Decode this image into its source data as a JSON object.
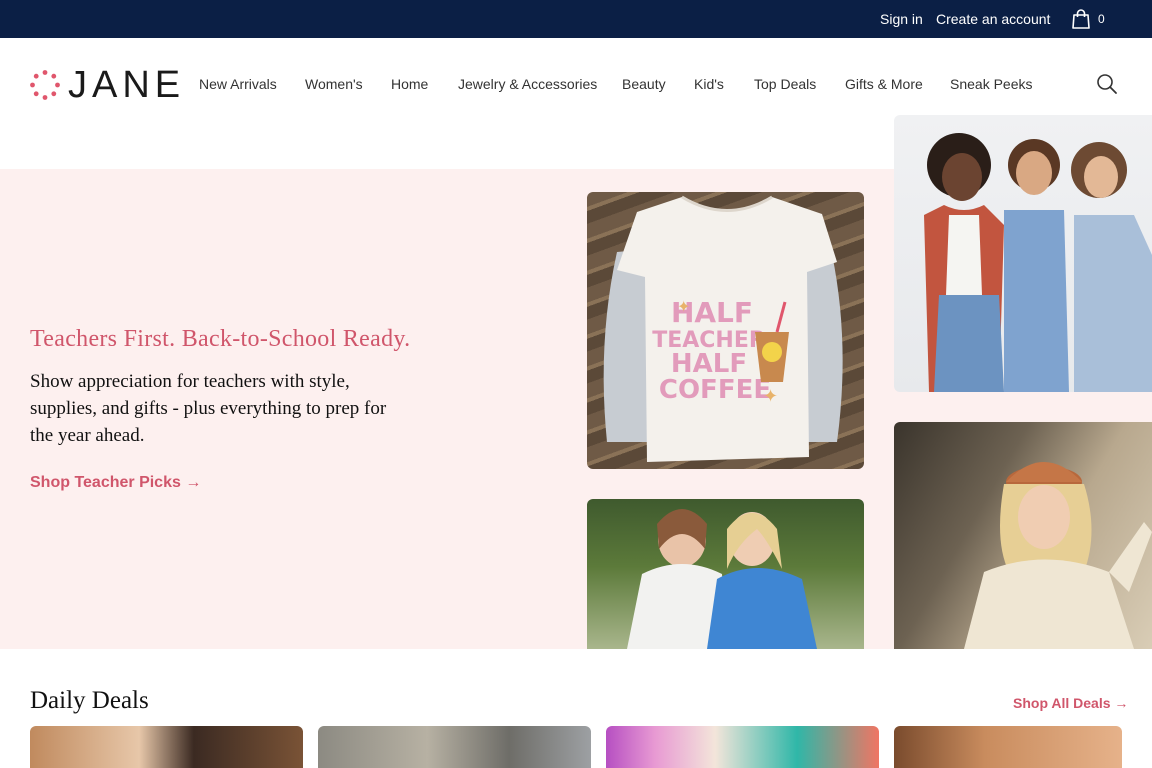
{
  "topbar": {
    "sign_in": "Sign in",
    "create_account": "Create an account",
    "cart_count": "0"
  },
  "header": {
    "logo_text": "JANE",
    "nav": [
      {
        "label": "New Arrivals"
      },
      {
        "label": "Women's"
      },
      {
        "label": "Home"
      },
      {
        "label": "Jewelry & Accessories"
      },
      {
        "label": "Beauty"
      },
      {
        "label": "Kid's"
      },
      {
        "label": "Top Deals"
      },
      {
        "label": "Gifts & More"
      },
      {
        "label": "Sneak Peeks"
      }
    ]
  },
  "hero": {
    "headline": "Teachers First. Back-to-School Ready.",
    "body": "Show appreciation for teachers with style, supplies, and gifts - plus everything to prep for the year ahead.",
    "cta": "Shop Teacher Picks →",
    "shirt_text": [
      "HALF",
      "TEACHER",
      "HALF",
      "COFFEE"
    ]
  },
  "deals": {
    "title": "Daily Deals",
    "link": "Shop All Deals →"
  },
  "colors": {
    "topbar": "#0b1f45",
    "accent": "#d0566b",
    "hero_bg": "#fdf0ef"
  }
}
